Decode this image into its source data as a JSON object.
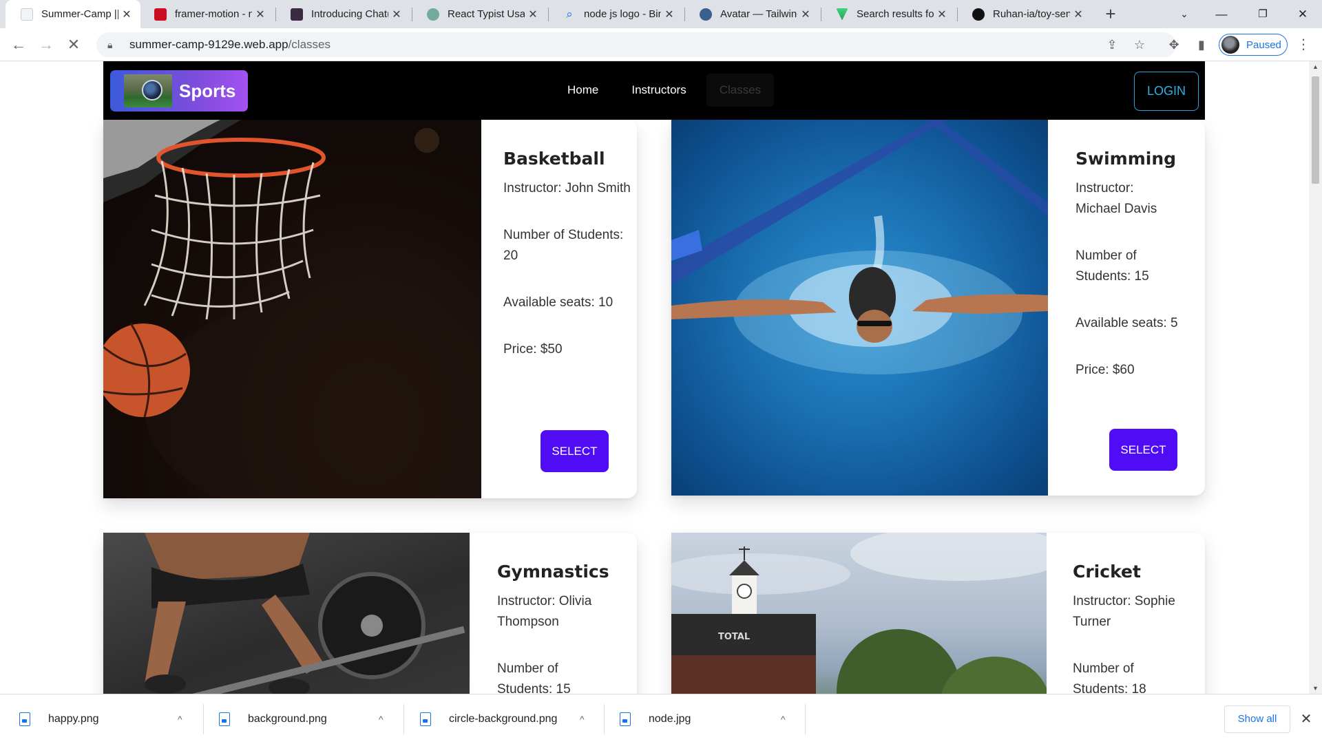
{
  "browser": {
    "tabs": [
      {
        "label": "Summer-Camp ||",
        "favicon_color": "#e8eaed",
        "active": true
      },
      {
        "label": "framer-motion - n",
        "favicon_color": "#cb0d21"
      },
      {
        "label": "Introducing Chat(",
        "favicon_color": "#3a2a44"
      },
      {
        "label": "React Typist Usag",
        "favicon_color": "#74aa9c"
      },
      {
        "label": "node js logo - Bin",
        "favicon_color": "#ffffff"
      },
      {
        "label": "Avatar — Tailwinc",
        "favicon_color": "#3b5f8f"
      },
      {
        "label": "Search results for",
        "favicon_color": "#3fd47a"
      },
      {
        "label": "Ruhan-ia/toy-sen",
        "favicon_color": "#111111"
      }
    ],
    "url_host": "summer-camp-9129e.web.app",
    "url_path": "/classes",
    "profile_label": "Paused"
  },
  "site": {
    "logo_text": "Sports",
    "nav": {
      "home": "Home",
      "instructors": "Instructors",
      "classes": "Classes"
    },
    "login_label": "LOGIN",
    "accent_color": "#4f0cf5"
  },
  "classes": [
    {
      "name": "Basketball",
      "instructor": "Instructor: John Smith",
      "students": "Number of Students: 20",
      "seats": "Available seats: 10",
      "price": "Price: $50",
      "button": "SELECT"
    },
    {
      "name": "Swimming",
      "instructor": "Instructor: Michael Davis",
      "students": "Number of Students: 15",
      "seats": "Available seats: 5",
      "price": "Price: $60",
      "button": "SELECT"
    },
    {
      "name": "Gymnastics",
      "instructor": "Instructor: Olivia Thompson",
      "students": "Number of Students: 15"
    },
    {
      "name": "Cricket",
      "instructor": "Instructor: Sophie Turner",
      "students": "Number of Students: 18"
    }
  ],
  "cricket_scoreboard_text": "TOTAL",
  "downloads": {
    "items": [
      "happy.png",
      "background.png",
      "circle-background.png",
      "node.jpg"
    ],
    "show_all": "Show all"
  }
}
